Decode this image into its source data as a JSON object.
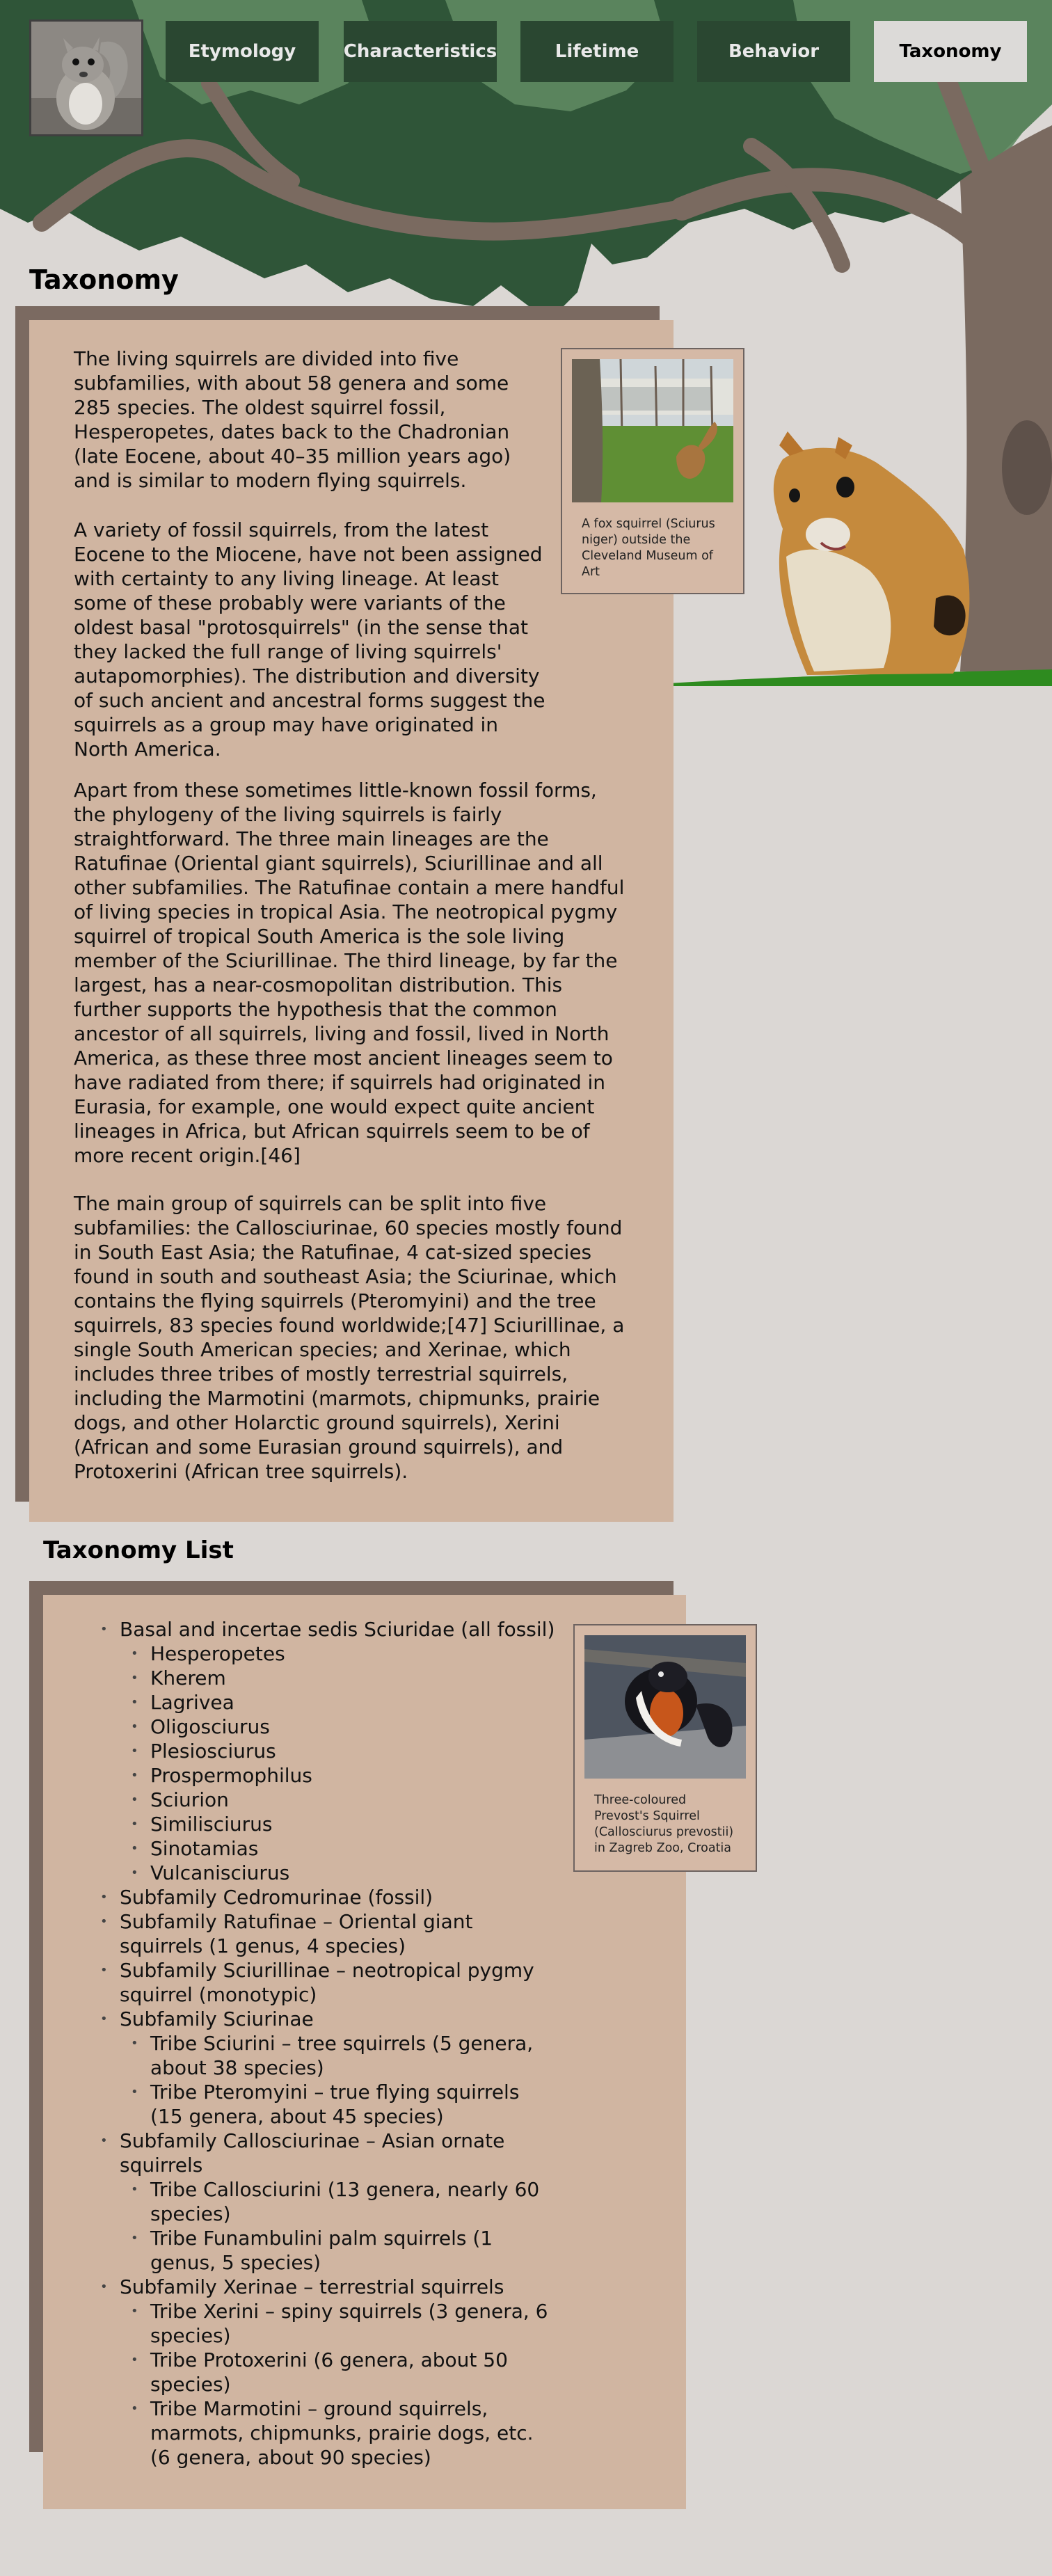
{
  "nav": {
    "items": [
      {
        "label": "Etymology",
        "active": false
      },
      {
        "label": "Characteristics",
        "active": false
      },
      {
        "label": "Lifetime",
        "active": false
      },
      {
        "label": "Behavior",
        "active": false
      },
      {
        "label": "Taxonomy",
        "active": true
      }
    ]
  },
  "colors": {
    "background": "#dbd7d4",
    "nav_button": "#2a4731",
    "nav_button_active": "#dcdad8",
    "panel": "#d0b5a1",
    "panel_shadow": "#7b6a61",
    "tree_leaves": "#2f5538",
    "tree_trunk": "#7a6a60",
    "grass": "#2e8b1f"
  },
  "taxonomy": {
    "title": "Taxonomy",
    "paragraphs": [
      "The living squirrels are divided into five subfamilies, with about 58 genera and some 285 species. The oldest squirrel fossil, Hesperopetes, dates back to the Chadronian (late Eocene, about 40–35 million years ago) and is similar to modern flying squirrels.",
      "A variety of fossil squirrels, from the latest Eocene to the Miocene, have not been assigned with certainty to any living lineage. At least some of these probably were variants of the oldest basal \"protosquirrels\" (in the sense that they lacked the full range of living squirrels' autapomorphies). The distribution and diversity of such ancient and ancestral forms suggest the squirrels as a group may have originated in North America.",
      "Apart from these sometimes little-known fossil forms, the phylogeny of the living squirrels is fairly straightforward. The three main lineages are the Ratufinae (Oriental giant squirrels), Sciurillinae and all other subfamilies. The Ratufinae contain a mere handful of living species in tropical Asia. The neotropical pygmy squirrel of tropical South America is the sole living member of the Sciurillinae. The third lineage, by far the largest, has a near-cosmopolitan distribution. This further supports the hypothesis that the common ancestor of all squirrels, living and fossil, lived in North America, as these three most ancient lineages seem to have radiated from there; if squirrels had originated in Eurasia, for example, one would expect quite ancient lineages in Africa, but African squirrels seem to be of more recent origin.[46]",
      "The main group of squirrels can be split into five subfamilies: the Callosciurinae, 60 species mostly found in South East Asia; the Ratufinae, 4 cat-sized species found in south and southeast Asia; the Sciurinae, which contains the flying squirrels (Pteromyini) and the tree squirrels, 83 species found worldwide;[47] Sciurillinae, a single South American species; and Xerinae, which includes three tribes of mostly terrestrial squirrels, including the Marmotini (marmots, chipmunks, prairie dogs, and other Holarctic ground squirrels), Xerini (African and some Eurasian ground squirrels), and Protoxerini (African tree squirrels)."
    ],
    "figure_caption": "A fox squirrel (Sciurus niger) outside the Cleveland Museum of Art"
  },
  "taxonomy_list": {
    "title": "Taxonomy List",
    "figure_caption": "Three-coloured Prevost's Squirrel (Callosciurus prevostii) in Zagreb Zoo, Croatia",
    "items": [
      {
        "text": "Basal and incertae sedis Sciuridae (all fossil)",
        "children": [
          {
            "text": "Hesperopetes"
          },
          {
            "text": "Kherem"
          },
          {
            "text": "Lagrivea"
          },
          {
            "text": "Oligosciurus"
          },
          {
            "text": "Plesiosciurus"
          },
          {
            "text": "Prospermophilus"
          },
          {
            "text": "Sciurion"
          },
          {
            "text": "Similisciurus"
          },
          {
            "text": "Sinotamias"
          },
          {
            "text": "Vulcanisciurus"
          }
        ]
      },
      {
        "text": "Subfamily Cedromurinae (fossil)"
      },
      {
        "text": "Subfamily Ratufinae – Oriental giant squirrels (1 genus, 4 species)"
      },
      {
        "text": "Subfamily Sciurillinae – neotropical pygmy squirrel (monotypic)"
      },
      {
        "text": "Subfamily Sciurinae",
        "children": [
          {
            "text": "Tribe Sciurini – tree squirrels (5 genera, about 38 species)"
          },
          {
            "text": "Tribe Pteromyini – true flying squirrels (15 genera, about 45 species)"
          }
        ]
      },
      {
        "text": "Subfamily Callosciurinae – Asian ornate squirrels",
        "children": [
          {
            "text": "Tribe Callosciurini (13 genera, nearly 60 species)"
          },
          {
            "text": "Tribe Funambulini palm squirrels (1 genus, 5 species)"
          }
        ]
      },
      {
        "text": "Subfamily Xerinae – terrestrial squirrels",
        "children": [
          {
            "text": "Tribe Xerini – spiny squirrels (3 genera, 6 species)"
          },
          {
            "text": "Tribe Protoxerini (6 genera, about 50 species)"
          },
          {
            "text": "Tribe Marmotini – ground squirrels, marmots, chipmunks, prairie dogs, etc. (6 genera, about 90 species)"
          }
        ]
      }
    ]
  },
  "icons": {
    "logo": "squirrel-photo-icon",
    "figure1": "fox-squirrel-photo",
    "figure2": "prevosts-squirrel-photo"
  }
}
